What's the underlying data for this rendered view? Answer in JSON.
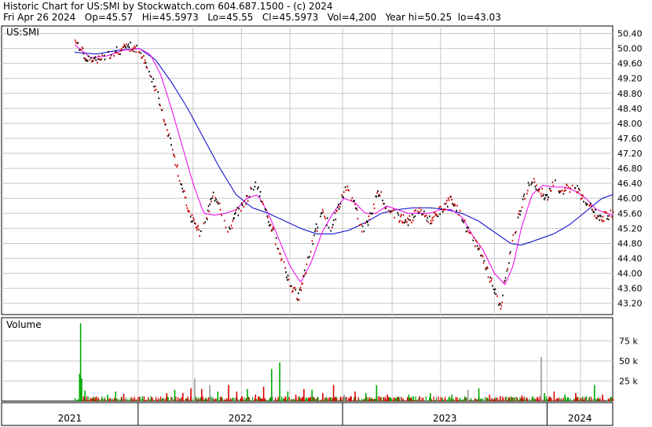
{
  "header": {
    "title_line": "Historic Chart for US:SMI by Stockwatch.com 604.687.1500 - (c) 2024",
    "date": "Fri Apr 26 2024",
    "op": "Op=45.57",
    "hi": "Hi=45.5973",
    "lo": "Lo=45.55",
    "cl": "Cl=45.5973",
    "vol": "Vol=4,200",
    "year_hi": "Year hi=50.25",
    "year_lo": "lo=43.03"
  },
  "colors": {
    "up": "#00aa00",
    "down": "#dd0000",
    "neutral": "#999999",
    "ma_short": "#ee00ee",
    "ma_long": "#0000cc",
    "grid": "#c8c8c8"
  },
  "chart_data": [
    {
      "type": "scatter",
      "panel": "price",
      "symbol_label": "US:SMI",
      "ylim": [
        42.9,
        50.6
      ],
      "yticks": [
        "50.40",
        "50.00",
        "49.60",
        "49.20",
        "48.80",
        "48.40",
        "48.00",
        "47.60",
        "47.20",
        "46.80",
        "46.40",
        "46.00",
        "45.60",
        "45.20",
        "44.80",
        "44.40",
        "44.00",
        "43.60",
        "43.20"
      ],
      "x_years": [
        "2021",
        "2022",
        "2023",
        "2024"
      ],
      "x_year_fraction_start": 0.0,
      "price_keypoints": [
        [
          0.0,
          50.2
        ],
        [
          0.02,
          49.75
        ],
        [
          0.04,
          49.65
        ],
        [
          0.07,
          49.9
        ],
        [
          0.1,
          50.05
        ],
        [
          0.12,
          49.95
        ],
        [
          0.135,
          49.45
        ],
        [
          0.155,
          48.7
        ],
        [
          0.175,
          47.6
        ],
        [
          0.195,
          46.5
        ],
        [
          0.215,
          45.5
        ],
        [
          0.235,
          45.0
        ],
        [
          0.255,
          46.1
        ],
        [
          0.27,
          45.7
        ],
        [
          0.285,
          45.1
        ],
        [
          0.3,
          45.6
        ],
        [
          0.32,
          46.0
        ],
        [
          0.335,
          46.45
        ],
        [
          0.35,
          45.8
        ],
        [
          0.37,
          45.0
        ],
        [
          0.385,
          44.3
        ],
        [
          0.4,
          43.7
        ],
        [
          0.415,
          43.35
        ],
        [
          0.43,
          44.2
        ],
        [
          0.445,
          45.1
        ],
        [
          0.46,
          45.6
        ],
        [
          0.475,
          45.2
        ],
        [
          0.49,
          45.8
        ],
        [
          0.505,
          46.4
        ],
        [
          0.52,
          45.8
        ],
        [
          0.535,
          45.1
        ],
        [
          0.55,
          45.6
        ],
        [
          0.565,
          46.2
        ],
        [
          0.58,
          45.7
        ],
        [
          0.6,
          45.5
        ],
        [
          0.62,
          45.4
        ],
        [
          0.64,
          45.7
        ],
        [
          0.66,
          45.4
        ],
        [
          0.68,
          45.7
        ],
        [
          0.7,
          46.0
        ],
        [
          0.72,
          45.4
        ],
        [
          0.735,
          45.0
        ],
        [
          0.75,
          44.7
        ],
        [
          0.765,
          44.1
        ],
        [
          0.78,
          43.5
        ],
        [
          0.79,
          43.05
        ],
        [
          0.8,
          43.9
        ],
        [
          0.815,
          45.0
        ],
        [
          0.83,
          45.8
        ],
        [
          0.845,
          46.5
        ],
        [
          0.86,
          46.3
        ],
        [
          0.875,
          46.0
        ],
        [
          0.89,
          46.4
        ],
        [
          0.905,
          46.2
        ],
        [
          0.92,
          46.3
        ],
        [
          0.935,
          46.2
        ],
        [
          0.95,
          45.9
        ],
        [
          0.965,
          45.6
        ],
        [
          0.98,
          45.5
        ],
        [
          1.0,
          45.6
        ]
      ],
      "ma_short_keypoints": [
        [
          0.0,
          50.1
        ],
        [
          0.03,
          49.75
        ],
        [
          0.06,
          49.8
        ],
        [
          0.09,
          49.95
        ],
        [
          0.12,
          50.0
        ],
        [
          0.14,
          49.85
        ],
        [
          0.16,
          49.3
        ],
        [
          0.18,
          48.4
        ],
        [
          0.2,
          47.4
        ],
        [
          0.22,
          46.4
        ],
        [
          0.24,
          45.6
        ],
        [
          0.26,
          45.55
        ],
        [
          0.28,
          45.6
        ],
        [
          0.3,
          45.7
        ],
        [
          0.32,
          46.0
        ],
        [
          0.34,
          46.1
        ],
        [
          0.36,
          45.6
        ],
        [
          0.38,
          44.9
        ],
        [
          0.4,
          44.2
        ],
        [
          0.42,
          43.75
        ],
        [
          0.44,
          44.3
        ],
        [
          0.46,
          45.1
        ],
        [
          0.48,
          45.6
        ],
        [
          0.5,
          46.0
        ],
        [
          0.52,
          45.9
        ],
        [
          0.54,
          45.6
        ],
        [
          0.56,
          45.6
        ],
        [
          0.58,
          45.8
        ],
        [
          0.6,
          45.7
        ],
        [
          0.62,
          45.6
        ],
        [
          0.64,
          45.6
        ],
        [
          0.66,
          45.6
        ],
        [
          0.68,
          45.7
        ],
        [
          0.7,
          45.7
        ],
        [
          0.72,
          45.5
        ],
        [
          0.74,
          45.0
        ],
        [
          0.76,
          44.6
        ],
        [
          0.78,
          44.0
        ],
        [
          0.8,
          43.7
        ],
        [
          0.815,
          44.2
        ],
        [
          0.83,
          45.2
        ],
        [
          0.85,
          46.1
        ],
        [
          0.87,
          46.35
        ],
        [
          0.89,
          46.3
        ],
        [
          0.91,
          46.3
        ],
        [
          0.93,
          46.2
        ],
        [
          0.95,
          46.0
        ],
        [
          0.97,
          45.7
        ],
        [
          1.0,
          45.55
        ]
      ],
      "ma_long_keypoints": [
        [
          0.0,
          49.9
        ],
        [
          0.04,
          49.85
        ],
        [
          0.08,
          49.95
        ],
        [
          0.12,
          50.0
        ],
        [
          0.15,
          49.7
        ],
        [
          0.18,
          49.1
        ],
        [
          0.21,
          48.4
        ],
        [
          0.24,
          47.6
        ],
        [
          0.27,
          46.8
        ],
        [
          0.3,
          46.1
        ],
        [
          0.33,
          45.75
        ],
        [
          0.36,
          45.6
        ],
        [
          0.39,
          45.4
        ],
        [
          0.42,
          45.2
        ],
        [
          0.45,
          45.05
        ],
        [
          0.48,
          45.05
        ],
        [
          0.51,
          45.15
        ],
        [
          0.54,
          45.35
        ],
        [
          0.57,
          45.6
        ],
        [
          0.6,
          45.7
        ],
        [
          0.63,
          45.75
        ],
        [
          0.66,
          45.75
        ],
        [
          0.69,
          45.7
        ],
        [
          0.72,
          45.6
        ],
        [
          0.75,
          45.4
        ],
        [
          0.78,
          45.1
        ],
        [
          0.81,
          44.8
        ],
        [
          0.83,
          44.75
        ],
        [
          0.86,
          44.9
        ],
        [
          0.89,
          45.05
        ],
        [
          0.92,
          45.3
        ],
        [
          0.95,
          45.65
        ],
        [
          0.98,
          46.0
        ],
        [
          1.0,
          46.1
        ]
      ]
    },
    {
      "type": "bar",
      "panel": "volume",
      "title": "Volume",
      "ylim": [
        0,
        100
      ],
      "yticks": [
        "75 k",
        "50 k",
        "25 k"
      ],
      "ytick_values": [
        75,
        50,
        25
      ],
      "unit": "k",
      "spikes": [
        [
          0.01,
          97,
          "up"
        ],
        [
          0.008,
          34,
          "up"
        ],
        [
          0.012,
          28,
          "up"
        ],
        [
          0.018,
          13,
          "up"
        ],
        [
          0.06,
          8,
          "up"
        ],
        [
          0.075,
          12,
          "up"
        ],
        [
          0.09,
          9,
          "down"
        ],
        [
          0.125,
          6,
          "up"
        ],
        [
          0.17,
          10,
          "down"
        ],
        [
          0.185,
          14,
          "up"
        ],
        [
          0.2,
          10,
          "down"
        ],
        [
          0.215,
          16,
          "down"
        ],
        [
          0.222,
          28,
          "neutral"
        ],
        [
          0.235,
          15,
          "down"
        ],
        [
          0.25,
          20,
          "neutral"
        ],
        [
          0.265,
          12,
          "up"
        ],
        [
          0.285,
          20,
          "down"
        ],
        [
          0.3,
          12,
          "down"
        ],
        [
          0.32,
          15,
          "up"
        ],
        [
          0.335,
          8,
          "down"
        ],
        [
          0.35,
          18,
          "down"
        ],
        [
          0.365,
          40,
          "up"
        ],
        [
          0.38,
          48,
          "up"
        ],
        [
          0.395,
          12,
          "up"
        ],
        [
          0.41,
          8,
          "down"
        ],
        [
          0.425,
          15,
          "down"
        ],
        [
          0.44,
          14,
          "up"
        ],
        [
          0.46,
          10,
          "down"
        ],
        [
          0.48,
          20,
          "down"
        ],
        [
          0.5,
          8,
          "neutral"
        ],
        [
          0.52,
          12,
          "down"
        ],
        [
          0.54,
          10,
          "up"
        ],
        [
          0.56,
          20,
          "up"
        ],
        [
          0.58,
          8,
          "down"
        ],
        [
          0.6,
          5,
          "down"
        ],
        [
          0.62,
          8,
          "up"
        ],
        [
          0.64,
          6,
          "down"
        ],
        [
          0.66,
          10,
          "up"
        ],
        [
          0.68,
          5,
          "down"
        ],
        [
          0.7,
          8,
          "up"
        ],
        [
          0.73,
          14,
          "neutral"
        ],
        [
          0.75,
          16,
          "up"
        ],
        [
          0.77,
          8,
          "down"
        ],
        [
          0.79,
          6,
          "down"
        ],
        [
          0.81,
          5,
          "up"
        ],
        [
          0.83,
          7,
          "down"
        ],
        [
          0.85,
          6,
          "up"
        ],
        [
          0.866,
          55,
          "neutral"
        ],
        [
          0.872,
          10,
          "up"
        ],
        [
          0.89,
          12,
          "down"
        ],
        [
          0.91,
          8,
          "up"
        ],
        [
          0.93,
          10,
          "down"
        ],
        [
          0.95,
          6,
          "up"
        ],
        [
          0.965,
          20,
          "up"
        ],
        [
          0.98,
          8,
          "down"
        ],
        [
          0.995,
          5,
          "up"
        ]
      ]
    }
  ]
}
